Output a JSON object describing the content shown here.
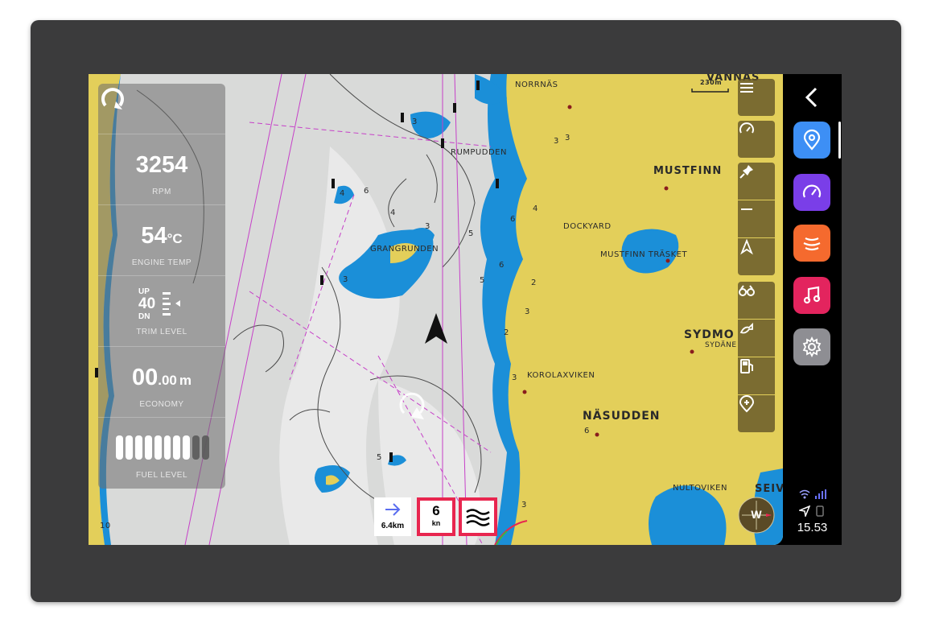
{
  "map": {
    "scale_label": "230m",
    "places": {
      "vannas": "VANNÄS",
      "norrnas": "NORRNÄS",
      "rumpudden": "RUMPUDDEN",
      "mustfinn": "MUSTFINN",
      "dockyard": "DOCKYARD",
      "mustfinn_trasket": "MUSTFINN TRÄSKET",
      "grangrunden": "GRANGRUNDEN",
      "sydmo": "SYDMO",
      "sydanan": "SYDÄNE",
      "korolaxviken": "KOROLAXVIKEN",
      "nasudden": "NÄSUDDEN",
      "nultoviken": "NULTOVIKEN",
      "seiv": "SEIV"
    },
    "depths": [
      "3",
      "6",
      "4",
      "4",
      "3",
      "5",
      "5",
      "6",
      "3",
      "6",
      "2",
      "3",
      "3",
      "2",
      "3",
      "4",
      "5",
      "10",
      "3",
      "6",
      "3"
    ]
  },
  "panel": {
    "rpm": {
      "value": "3254",
      "label": "RPM"
    },
    "engine_temp": {
      "value": "54",
      "unit": "°C",
      "label": "ENGINE TEMP"
    },
    "trim": {
      "up": "UP",
      "value": "40",
      "down": "DN",
      "label": "TRIM LEVEL"
    },
    "economy": {
      "value": "00",
      "decimals": ".00",
      "unit": "m",
      "label": "ECONOMY"
    },
    "fuel": {
      "label": "FUEL LEVEL",
      "level": 0.8
    }
  },
  "widgets": {
    "distance": "6.4km",
    "speed": "6",
    "speed_unit": "kn"
  },
  "compass": {
    "heading": "W"
  },
  "status": {
    "time": "15.53"
  },
  "colors": {
    "land": "#e3cf5a",
    "shallow_water": "#1b8fd8",
    "deep_water": "#d8d9d8",
    "alert": "#e8264f",
    "toolbar": "#64552a"
  },
  "icons": {
    "sync": "sync-icon",
    "menu": "menu-icon",
    "gauge": "gauge-icon",
    "pin": "pin-icon",
    "zoom_out": "minus-icon",
    "north_up": "north-up-icon",
    "binoculars": "binoculars-icon",
    "fishing": "fishing-icon",
    "fuel_station": "fuel-station-icon",
    "add_location": "add-location-icon",
    "back": "chevron-left-icon",
    "location_app": "location-pin-icon",
    "speed_app": "speedometer-icon",
    "sonar_app": "sonar-icon",
    "music_app": "music-note-icon",
    "settings_app": "gear-icon",
    "wifi": "wifi-icon",
    "signal": "signal-icon",
    "gps": "gps-arrow-icon",
    "phone": "phone-icon"
  }
}
